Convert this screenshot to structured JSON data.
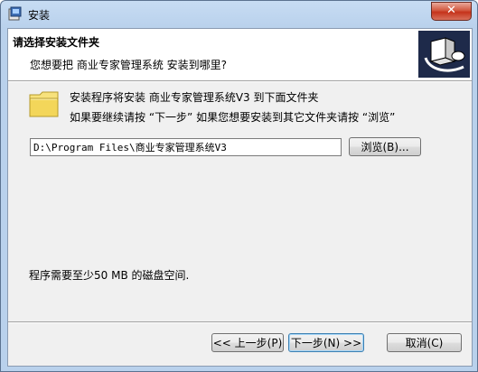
{
  "window": {
    "title": "安装",
    "close_label": "✕"
  },
  "header": {
    "title": "请选择安装文件夹",
    "subtitle": "您想要把 商业专家管理系统 安装到哪里?"
  },
  "body": {
    "info_line1": "安装程序将安装 商业专家管理系统V3 到下面文件夹",
    "info_line2": "如果要继续请按 “下一步” 如果您想要安装到其它文件夹请按 “浏览”",
    "install_path": "D:\\Program Files\\商业专家管理系统V3",
    "browse_label": "浏览(B)...",
    "space_required": "程序需要至少50 MB 的磁盘空间."
  },
  "footer": {
    "back_label": "<< 上一步(P)",
    "next_label": "下一步(N) >>",
    "cancel_label": "取消(C)"
  },
  "icons": [
    "setup-app-icon",
    "folder-icon",
    "installer-logo-icon",
    "close-icon"
  ],
  "colors": {
    "title_bar": "#b9d1ec",
    "close_button": "#c5331b",
    "dialog_bg": "#f0f0f0"
  }
}
